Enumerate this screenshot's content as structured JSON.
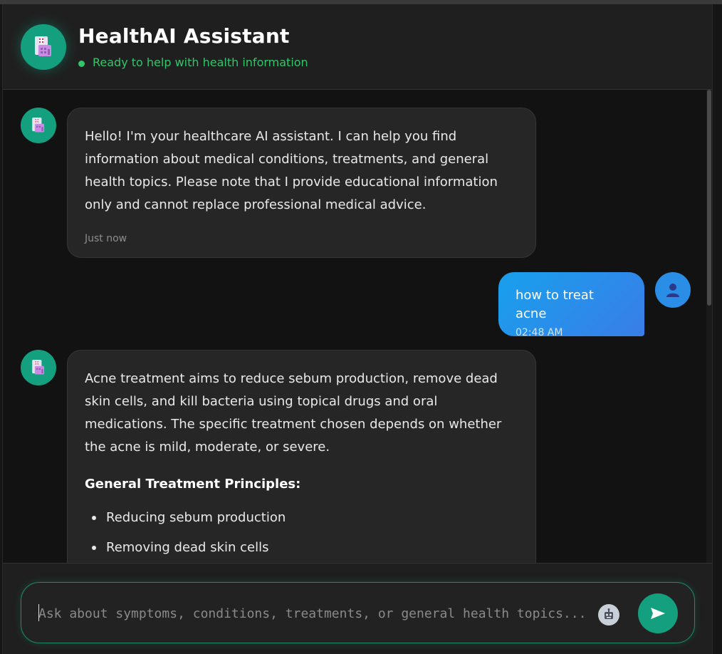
{
  "header": {
    "title": "HealthAI Assistant",
    "status": "Ready to help with health information",
    "avatar_icon": "hospital-icon"
  },
  "messages": [
    {
      "role": "assistant",
      "text": "Hello! I'm your healthcare AI assistant. I can help you find information about medical conditions, treatments, and general health topics. Please note that I provide educational information only and cannot replace professional medical advice.",
      "time": "Just now"
    },
    {
      "role": "user",
      "text": "how to treat acne",
      "time": "02:48 AM"
    },
    {
      "role": "assistant",
      "intro": "Acne treatment aims to reduce sebum production, remove dead skin cells, and kill bacteria using topical drugs and oral medications. The specific treatment chosen depends on whether the acne is mild, moderate, or severe.",
      "heading": "General Treatment Principles:",
      "points": [
        "Reducing sebum production",
        "Removing dead skin cells"
      ]
    }
  ],
  "composer": {
    "placeholder": "Ask about symptoms, conditions, treatments, or general health topics...",
    "assist_icon": "robot-icon",
    "send_icon": "send-icon"
  },
  "colors": {
    "accent": "#14a07e",
    "status": "#34c46b",
    "user_bubble_start": "#18a0ec",
    "user_bubble_end": "#3a7de8",
    "background": "#121212"
  }
}
